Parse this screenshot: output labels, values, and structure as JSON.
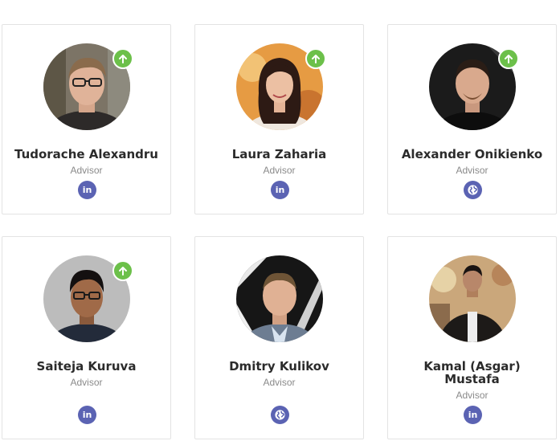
{
  "colors": {
    "badge": "#6cc04a",
    "social": "#5b63b3",
    "border": "#e3e3e3"
  },
  "team": [
    {
      "name": "Tudorache Alexandru",
      "role": "Advisor",
      "social_icon": "linkedin-icon",
      "social_text": "in",
      "badge": "arrow-up-icon"
    },
    {
      "name": "Laura Zaharia",
      "role": "Advisor",
      "social_icon": "linkedin-icon",
      "social_text": "in",
      "badge": "arrow-up-icon"
    },
    {
      "name": "Alexander Onikienko",
      "role": "Advisor",
      "social_icon": "globe-icon",
      "social_text": "",
      "badge": "arrow-up-icon"
    },
    {
      "name": "Saiteja Kuruva",
      "role": "Advisor",
      "social_icon": "linkedin-icon",
      "social_text": "in",
      "badge": "arrow-up-icon"
    },
    {
      "name": "Dmitry Kulikov",
      "role": "Advisor",
      "social_icon": "globe-icon",
      "social_text": ""
    },
    {
      "name": "Kamal (Asgar) Mustafa",
      "role": "Advisor",
      "social_icon": "linkedin-icon",
      "social_text": "in"
    }
  ]
}
